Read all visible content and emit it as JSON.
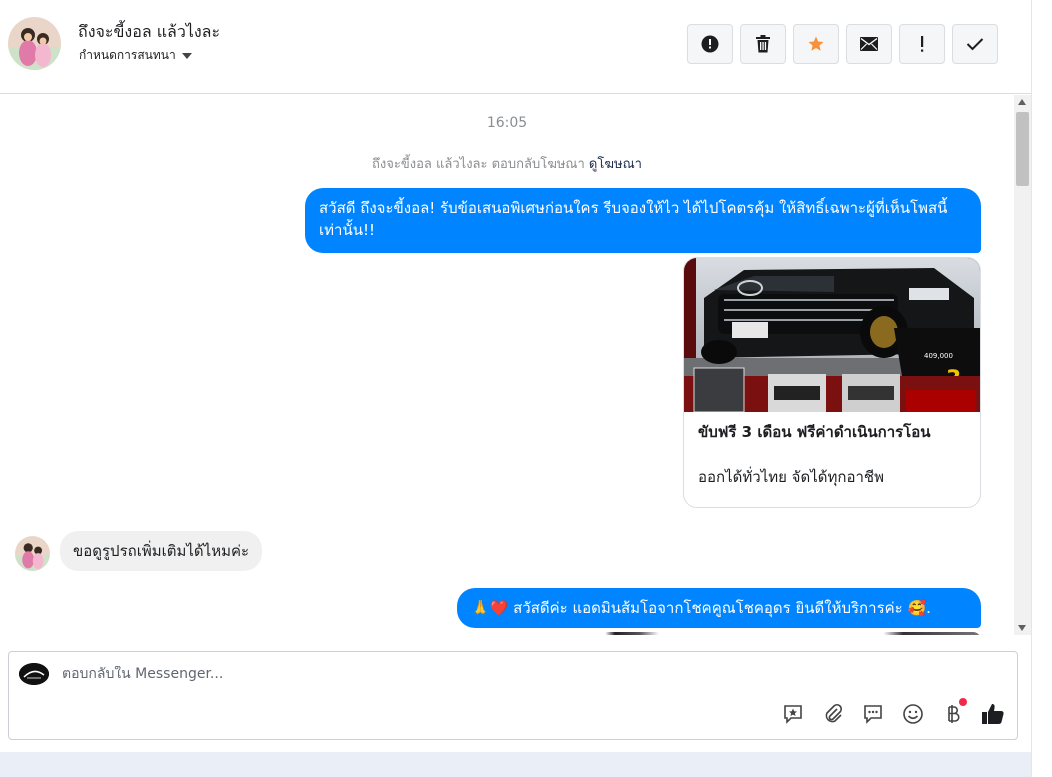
{
  "header": {
    "title": "ถึงจะขี้งอล แล้วไงละ",
    "subtitle": "กำหนดการสนทนา",
    "actions": [
      {
        "name": "spam-button",
        "icon": "alert-circle-icon",
        "color": "#1c1e21"
      },
      {
        "name": "delete-button",
        "icon": "trash-icon",
        "color": "#1c1e21"
      },
      {
        "name": "star-button",
        "icon": "star-icon",
        "color": "#f7923b"
      },
      {
        "name": "mark-unread-button",
        "icon": "envelope-icon",
        "color": "#1c1e21"
      },
      {
        "name": "follow-up-button",
        "icon": "exclamation-icon",
        "color": "#1c1e21"
      },
      {
        "name": "mark-done-button",
        "icon": "check-icon",
        "color": "#1c1e21"
      }
    ]
  },
  "thread": {
    "timestamp": "16:05",
    "ad_note": {
      "text": "ถึงจะขี้งอล แล้วไงละ ตอบกลับโฆษณา",
      "link": "ดูโฆษณา"
    },
    "messages": [
      {
        "id": "m1",
        "direction": "outgoing",
        "text": "สวัสดี ถึงจะขี้งอล! รับข้อเสนอพิเศษก่อนใคร รีบจองให้ไว ได้ไปโคตรคุ้ม ให้สิทธิ์เฉพาะผู้ที่เห็นโพสนี้เท่านั้น!!"
      },
      {
        "id": "m2",
        "direction": "outgoing",
        "type": "card",
        "title": "ขับฟรี 3 เดือน ฟรีค่าดำเนินการโอน",
        "description": "ออกได้ทั่วไทย จัดได้ทุกอาชีพ",
        "image_price_text": "409,000",
        "image_badge_text": "3"
      },
      {
        "id": "m3",
        "direction": "incoming",
        "text": "ขอดูรูปรถเพิ่มเติมได้ไหมค่ะ"
      },
      {
        "id": "m4",
        "direction": "outgoing",
        "text": "🙏❤️ สวัสดีค่ะ แอดมินส้มโอจากโชคคูณโชคอุดร ยินดีให้บริการค่ะ 🥰."
      }
    ]
  },
  "composer": {
    "placeholder": "ตอบกลับใน Messenger...",
    "value": "",
    "tools": [
      "saved-reply-icon",
      "attachment-icon",
      "chat-bubble-icon",
      "emoji-icon",
      "baht-payment-icon",
      "thumbs-up-icon"
    ]
  },
  "colors": {
    "outgoing_bubble": "#0084ff",
    "incoming_bubble": "#f0f0f0",
    "star": "#f7923b",
    "notification_dot": "#f02849"
  }
}
